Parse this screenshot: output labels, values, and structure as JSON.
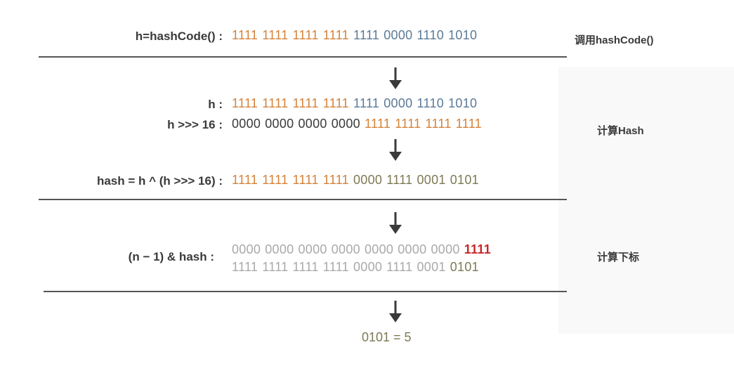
{
  "steps": {
    "step1": {
      "label": "h=hashCode() :",
      "bits": [
        {
          "text": "1111",
          "color": "orange"
        },
        {
          "text": "1111",
          "color": "orange"
        },
        {
          "text": "1111",
          "color": "orange"
        },
        {
          "text": "1111",
          "color": "orange"
        },
        {
          "text": "1111",
          "color": "blue"
        },
        {
          "text": "0000",
          "color": "blue"
        },
        {
          "text": "1110",
          "color": "blue"
        },
        {
          "text": "1010",
          "color": "blue"
        }
      ],
      "side_label": "调用hashCode()"
    },
    "step2": {
      "h_label": "h :",
      "h_bits": [
        {
          "text": "1111",
          "color": "orange"
        },
        {
          "text": "1111",
          "color": "orange"
        },
        {
          "text": "1111",
          "color": "orange"
        },
        {
          "text": "1111",
          "color": "orange"
        },
        {
          "text": "1111",
          "color": "blue"
        },
        {
          "text": "0000",
          "color": "blue"
        },
        {
          "text": "1110",
          "color": "blue"
        },
        {
          "text": "1010",
          "color": "blue"
        }
      ],
      "shift_label": "h >>> 16 :",
      "shift_bits": [
        {
          "text": "0000",
          "color": "dark"
        },
        {
          "text": "0000",
          "color": "dark"
        },
        {
          "text": "0000",
          "color": "dark"
        },
        {
          "text": "0000",
          "color": "dark"
        },
        {
          "text": "1111",
          "color": "orange"
        },
        {
          "text": "1111",
          "color": "orange"
        },
        {
          "text": "1111",
          "color": "orange"
        },
        {
          "text": "1111",
          "color": "orange"
        }
      ],
      "side_label": "计算Hash"
    },
    "step3": {
      "label": "hash = h ^ (h >>> 16) :",
      "bits": [
        {
          "text": "1111",
          "color": "orange"
        },
        {
          "text": "1111",
          "color": "orange"
        },
        {
          "text": "1111",
          "color": "orange"
        },
        {
          "text": "1111",
          "color": "orange"
        },
        {
          "text": "0000",
          "color": "olive"
        },
        {
          "text": "1111",
          "color": "olive"
        },
        {
          "text": "0001",
          "color": "olive"
        },
        {
          "text": "0101",
          "color": "olive"
        }
      ]
    },
    "step4": {
      "label": "(n − 1) & hash :",
      "mask_bits": [
        {
          "text": "0000",
          "color": "gray"
        },
        {
          "text": "0000",
          "color": "gray"
        },
        {
          "text": "0000",
          "color": "gray"
        },
        {
          "text": "0000",
          "color": "gray"
        },
        {
          "text": "0000",
          "color": "gray"
        },
        {
          "text": "0000",
          "color": "gray"
        },
        {
          "text": "0000",
          "color": "gray"
        },
        {
          "text": "1111",
          "color": "red"
        }
      ],
      "hash_bits": [
        {
          "text": "1111",
          "color": "gray"
        },
        {
          "text": "1111",
          "color": "gray"
        },
        {
          "text": "1111",
          "color": "gray"
        },
        {
          "text": "1111",
          "color": "gray"
        },
        {
          "text": "0000",
          "color": "gray"
        },
        {
          "text": "1111",
          "color": "gray"
        },
        {
          "text": "0001",
          "color": "gray"
        },
        {
          "text": "0101",
          "color": "olive"
        }
      ],
      "side_label": "计算下标"
    },
    "result": {
      "text": "0101 = 5"
    }
  },
  "colors": {
    "orange": "#d4823a",
    "blue": "#5a7a98",
    "dark": "#3a3a3a",
    "gray": "#a9a9a9",
    "olive": "#7e7a54",
    "red": "#c82828",
    "rule": "#555555"
  },
  "icons": {
    "arrow": "down-arrow-icon"
  }
}
